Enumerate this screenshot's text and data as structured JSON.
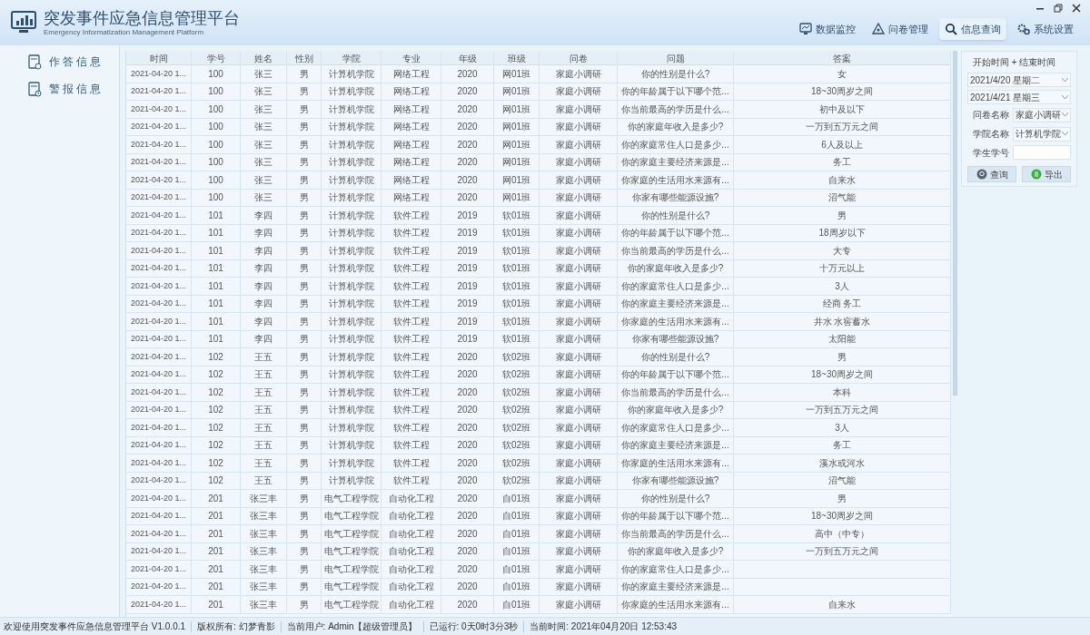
{
  "window": {
    "title": "突发事件应急信息管理平台",
    "subtitle": "Emergency Informatization Management Platform"
  },
  "nav": [
    {
      "label": "数据监控",
      "selected": false
    },
    {
      "label": "问卷管理",
      "selected": false
    },
    {
      "label": "信息查询",
      "selected": true
    },
    {
      "label": "系统设置",
      "selected": false
    }
  ],
  "sidebar": {
    "items": [
      {
        "label": "作答信息"
      },
      {
        "label": "警报信息"
      }
    ]
  },
  "table": {
    "columns": [
      "时间",
      "学号",
      "姓名",
      "性别",
      "学院",
      "专业",
      "年级",
      "班级",
      "问卷",
      "问题",
      "答案"
    ],
    "rows": [
      {
        "cells": [
          "2021-04-20 1...",
          "100",
          "张三",
          "男",
          "计算机学院",
          "网络工程",
          "2020",
          "网01班",
          "家庭小调研",
          "你的性别是什么?",
          "女"
        ]
      },
      {
        "cells": [
          "2021-04-20 1...",
          "100",
          "张三",
          "男",
          "计算机学院",
          "网络工程",
          "2020",
          "网01班",
          "家庭小调研",
          "你的年龄属于以下哪个范...",
          "18~30周岁之间"
        ]
      },
      {
        "cells": [
          "2021-04-20 1...",
          "100",
          "张三",
          "男",
          "计算机学院",
          "网络工程",
          "2020",
          "网01班",
          "家庭小调研",
          "你当前最高的学历是什么...",
          "初中及以下"
        ]
      },
      {
        "cells": [
          "2021-04-20 1...",
          "100",
          "张三",
          "男",
          "计算机学院",
          "网络工程",
          "2020",
          "网01班",
          "家庭小调研",
          "你的家庭年收入是多少?",
          "一万到五万元之间"
        ]
      },
      {
        "cells": [
          "2021-04-20 1...",
          "100",
          "张三",
          "男",
          "计算机学院",
          "网络工程",
          "2020",
          "网01班",
          "家庭小调研",
          "你的家庭常住人口是多少...",
          "6人及以上"
        ]
      },
      {
        "cells": [
          "2021-04-20 1...",
          "100",
          "张三",
          "男",
          "计算机学院",
          "网络工程",
          "2020",
          "网01班",
          "家庭小调研",
          "你的家庭主要经济来源是...",
          "务工"
        ]
      },
      {
        "cells": [
          "2021-04-20 1...",
          "100",
          "张三",
          "男",
          "计算机学院",
          "网络工程",
          "2020",
          "网01班",
          "家庭小调研",
          "你家庭的生活用水来源有...",
          "自来水"
        ]
      },
      {
        "cells": [
          "2021-04-20 1...",
          "100",
          "张三",
          "男",
          "计算机学院",
          "网络工程",
          "2020",
          "网01班",
          "家庭小调研",
          "你家有哪些能源设施?",
          "沼气能"
        ]
      },
      {
        "cells": [
          "2021-04-20 1...",
          "101",
          "李四",
          "男",
          "计算机学院",
          "软件工程",
          "2019",
          "软01班",
          "家庭小调研",
          "你的性别是什么?",
          "男"
        ]
      },
      {
        "cells": [
          "2021-04-20 1...",
          "101",
          "李四",
          "男",
          "计算机学院",
          "软件工程",
          "2019",
          "软01班",
          "家庭小调研",
          "你的年龄属于以下哪个范...",
          "18周岁以下"
        ]
      },
      {
        "cells": [
          "2021-04-20 1...",
          "101",
          "李四",
          "男",
          "计算机学院",
          "软件工程",
          "2019",
          "软01班",
          "家庭小调研",
          "你当前最高的学历是什么...",
          "大专"
        ]
      },
      {
        "cells": [
          "2021-04-20 1...",
          "101",
          "李四",
          "男",
          "计算机学院",
          "软件工程",
          "2019",
          "软01班",
          "家庭小调研",
          "你的家庭年收入是多少?",
          "十万元以上"
        ]
      },
      {
        "cells": [
          "2021-04-20 1...",
          "101",
          "李四",
          "男",
          "计算机学院",
          "软件工程",
          "2019",
          "软01班",
          "家庭小调研",
          "你的家庭常住人口是多少...",
          "3人"
        ]
      },
      {
        "cells": [
          "2021-04-20 1...",
          "101",
          "李四",
          "男",
          "计算机学院",
          "软件工程",
          "2019",
          "软01班",
          "家庭小调研",
          "你的家庭主要经济来源是...",
          "经商 务工"
        ]
      },
      {
        "cells": [
          "2021-04-20 1...",
          "101",
          "李四",
          "男",
          "计算机学院",
          "软件工程",
          "2019",
          "软01班",
          "家庭小调研",
          "你家庭的生活用水来源有...",
          "井水 水窖蓄水"
        ]
      },
      {
        "cells": [
          "2021-04-20 1...",
          "101",
          "李四",
          "男",
          "计算机学院",
          "软件工程",
          "2019",
          "软01班",
          "家庭小调研",
          "你家有哪些能源设施?",
          "太阳能"
        ]
      },
      {
        "cells": [
          "2021-04-20 1...",
          "102",
          "王五",
          "男",
          "计算机学院",
          "软件工程",
          "2020",
          "软02班",
          "家庭小调研",
          "你的性别是什么?",
          "男"
        ]
      },
      {
        "cells": [
          "2021-04-20 1...",
          "102",
          "王五",
          "男",
          "计算机学院",
          "软件工程",
          "2020",
          "软02班",
          "家庭小调研",
          "你的年龄属于以下哪个范...",
          "18~30周岁之间"
        ]
      },
      {
        "cells": [
          "2021-04-20 1...",
          "102",
          "王五",
          "男",
          "计算机学院",
          "软件工程",
          "2020",
          "软02班",
          "家庭小调研",
          "你当前最高的学历是什么...",
          "本科"
        ]
      },
      {
        "cells": [
          "2021-04-20 1...",
          "102",
          "王五",
          "男",
          "计算机学院",
          "软件工程",
          "2020",
          "软02班",
          "家庭小调研",
          "你的家庭年收入是多少?",
          "一万到五万元之间"
        ]
      },
      {
        "cells": [
          "2021-04-20 1...",
          "102",
          "王五",
          "男",
          "计算机学院",
          "软件工程",
          "2020",
          "软02班",
          "家庭小调研",
          "你的家庭常住人口是多少...",
          "3人"
        ]
      },
      {
        "cells": [
          "2021-04-20 1...",
          "102",
          "王五",
          "男",
          "计算机学院",
          "软件工程",
          "2020",
          "软02班",
          "家庭小调研",
          "你的家庭主要经济来源是...",
          "务工"
        ]
      },
      {
        "cells": [
          "2021-04-20 1...",
          "102",
          "王五",
          "男",
          "计算机学院",
          "软件工程",
          "2020",
          "软02班",
          "家庭小调研",
          "你家庭的生活用水来源有...",
          "溪水或河水"
        ]
      },
      {
        "cells": [
          "2021-04-20 1...",
          "102",
          "王五",
          "男",
          "计算机学院",
          "软件工程",
          "2020",
          "软02班",
          "家庭小调研",
          "你家有哪些能源设施?",
          "沼气能"
        ]
      },
      {
        "cells": [
          "2021-04-20 1...",
          "201",
          "张三丰",
          "男",
          "电气工程学院",
          "自动化工程",
          "2020",
          "自01班",
          "家庭小调研",
          "你的性别是什么?",
          "男"
        ]
      },
      {
        "cells": [
          "2021-04-20 1...",
          "201",
          "张三丰",
          "男",
          "电气工程学院",
          "自动化工程",
          "2020",
          "自01班",
          "家庭小调研",
          "你的年龄属于以下哪个范...",
          "18~30周岁之间"
        ]
      },
      {
        "cells": [
          "2021-04-20 1...",
          "201",
          "张三丰",
          "男",
          "电气工程学院",
          "自动化工程",
          "2020",
          "自01班",
          "家庭小调研",
          "你当前最高的学历是什么...",
          "高中（中专）"
        ]
      },
      {
        "cells": [
          "2021-04-20 1...",
          "201",
          "张三丰",
          "男",
          "电气工程学院",
          "自动化工程",
          "2020",
          "自01班",
          "家庭小调研",
          "你的家庭年收入是多少?",
          "一万到五万元之间"
        ]
      },
      {
        "cells": [
          "2021-04-20 1...",
          "201",
          "张三丰",
          "男",
          "电气工程学院",
          "自动化工程",
          "2020",
          "自01班",
          "家庭小调研",
          "你的家庭常住人口是多少..."
        ]
      },
      {
        "cells": [
          "2021-04-20 1...",
          "201",
          "张三丰",
          "男",
          "电气工程学院",
          "自动化工程",
          "2020",
          "自01班",
          "家庭小调研",
          "你的家庭主要经济来源是..."
        ]
      },
      {
        "cells": [
          "2021-04-20 1...",
          "201",
          "张三丰",
          "男",
          "电气工程学院",
          "自动化工程",
          "2020",
          "自01班",
          "家庭小调研",
          "你家庭的生活用水来源有...",
          "自来水"
        ]
      }
    ]
  },
  "filter": {
    "range_label": "开始时间 + 结束时间",
    "start_date": "2021/4/20 星期二",
    "end_date": "2021/4/21 星期三",
    "fields": [
      {
        "kind": "dropdown",
        "label": "问卷名称",
        "value": "家庭小调研"
      },
      {
        "kind": "dropdown",
        "label": "学院名称",
        "value": "计算机学院"
      },
      {
        "kind": "input",
        "label": "学生学号"
      }
    ],
    "buttons": [
      {
        "label": "查询"
      },
      {
        "label": "导出"
      }
    ]
  },
  "status_bar": [
    "欢迎使用突发事件应急信息管理平台 V1.0.0.1",
    "版权所有: 幻梦青影",
    "当前用户: Admin【超级管理员】",
    "已运行: 0天0时3分3秒",
    "当前时间: 2021年04月20日 12:53:43"
  ]
}
